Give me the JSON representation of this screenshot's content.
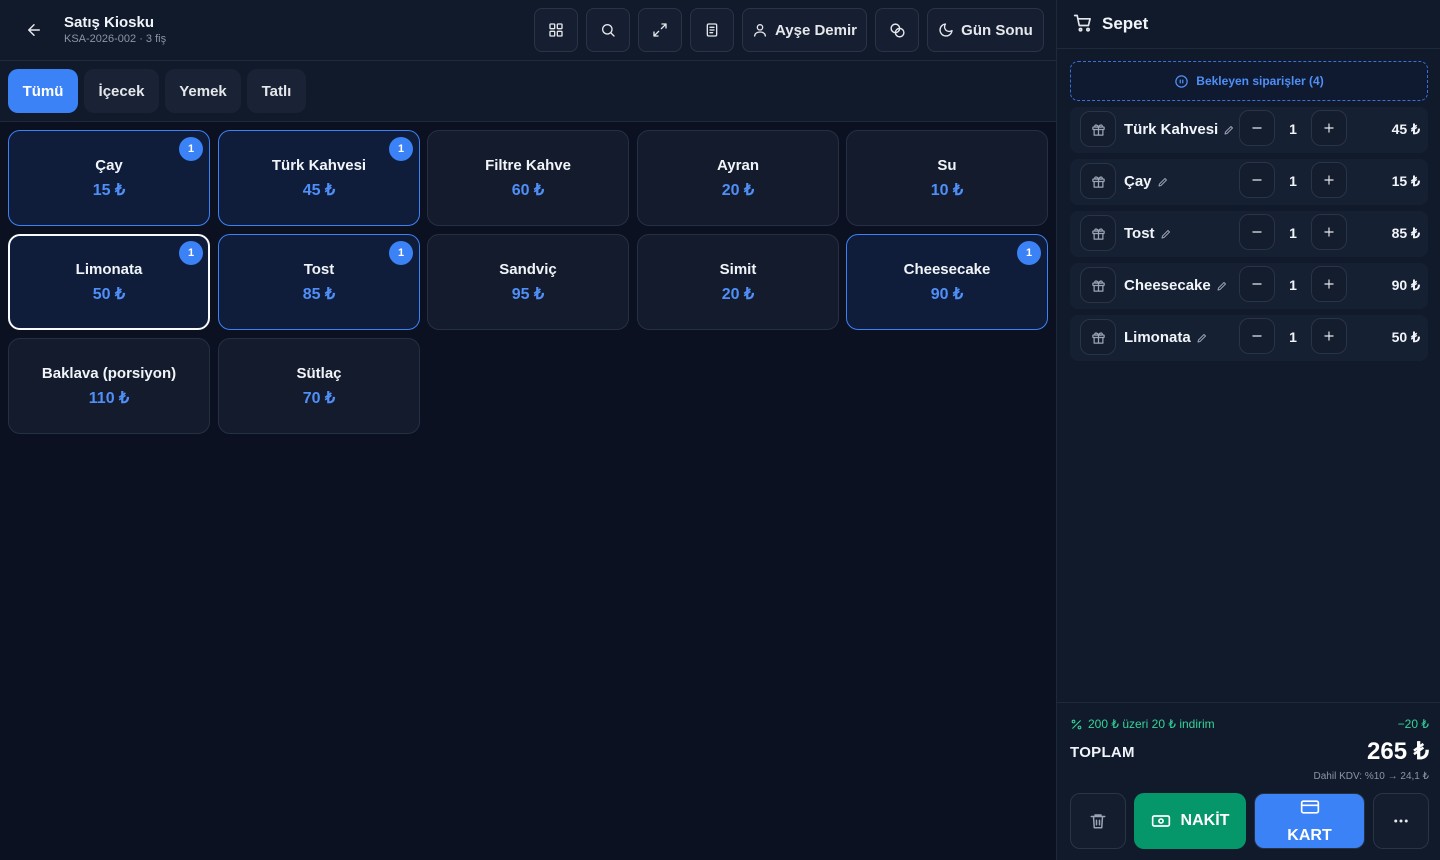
{
  "header": {
    "title": "Satış Kiosku",
    "subtitle": "KSA-2026-002 · 3 fiş",
    "user_name": "Ayşe Demir",
    "day_end_label": "Gün Sonu"
  },
  "tabs": [
    {
      "label": "Tümü",
      "active": true
    },
    {
      "label": "İçecek",
      "active": false
    },
    {
      "label": "Yemek",
      "active": false
    },
    {
      "label": "Tatlı",
      "active": false
    }
  ],
  "products": [
    {
      "name": "Çay",
      "price": "15 ₺",
      "count": "1"
    },
    {
      "name": "Türk Kahvesi",
      "price": "45 ₺",
      "count": "1"
    },
    {
      "name": "Filtre Kahve",
      "price": "60 ₺",
      "count": ""
    },
    {
      "name": "Ayran",
      "price": "20 ₺",
      "count": ""
    },
    {
      "name": "Su",
      "price": "10 ₺",
      "count": ""
    },
    {
      "name": "Limonata",
      "price": "50 ₺",
      "count": "1"
    },
    {
      "name": "Tost",
      "price": "85 ₺",
      "count": "1"
    },
    {
      "name": "Sandviç",
      "price": "95 ₺",
      "count": ""
    },
    {
      "name": "Simit",
      "price": "20 ₺",
      "count": ""
    },
    {
      "name": "Cheesecake",
      "price": "90 ₺",
      "count": "1"
    },
    {
      "name": "Baklava (porsiyon)",
      "price": "110 ₺",
      "count": ""
    },
    {
      "name": "Sütlaç",
      "price": "70 ₺",
      "count": ""
    }
  ],
  "cart": {
    "title": "Sepet",
    "pending_label": "Bekleyen siparişler (4)",
    "items": [
      {
        "name": "Türk Kahvesi",
        "qty": "1",
        "price": "45 ₺"
      },
      {
        "name": "Çay",
        "qty": "1",
        "price": "15 ₺"
      },
      {
        "name": "Tost",
        "qty": "1",
        "price": "85 ₺"
      },
      {
        "name": "Cheesecake",
        "qty": "1",
        "price": "90 ₺"
      },
      {
        "name": "Limonata",
        "qty": "1",
        "price": "50 ₺"
      }
    ],
    "discount_text": "200 ₺ üzeri 20 ₺ indirim",
    "discount_amount": "−20 ₺",
    "total_label": "TOPLAM",
    "total_value": "265 ₺",
    "vat_text": "Dahil KDV: %10 → 24,1 ₺",
    "cash_label": "NAKİT",
    "card_label": "KART"
  },
  "colors": {
    "accent": "#3b82f6",
    "cash": "#059669",
    "discount": "#34d399",
    "background": "#0b1120"
  },
  "icons": [
    "back-arrow-icon",
    "grid-icon",
    "search-icon",
    "expand-icon",
    "receipt-icon",
    "user-icon",
    "coins-icon",
    "moon-icon",
    "cart-icon",
    "pause-icon",
    "gift-icon",
    "pencil-icon",
    "minus-icon",
    "plus-icon",
    "percent-icon",
    "trash-icon",
    "cash-icon",
    "credit-card-icon",
    "more-icon"
  ]
}
